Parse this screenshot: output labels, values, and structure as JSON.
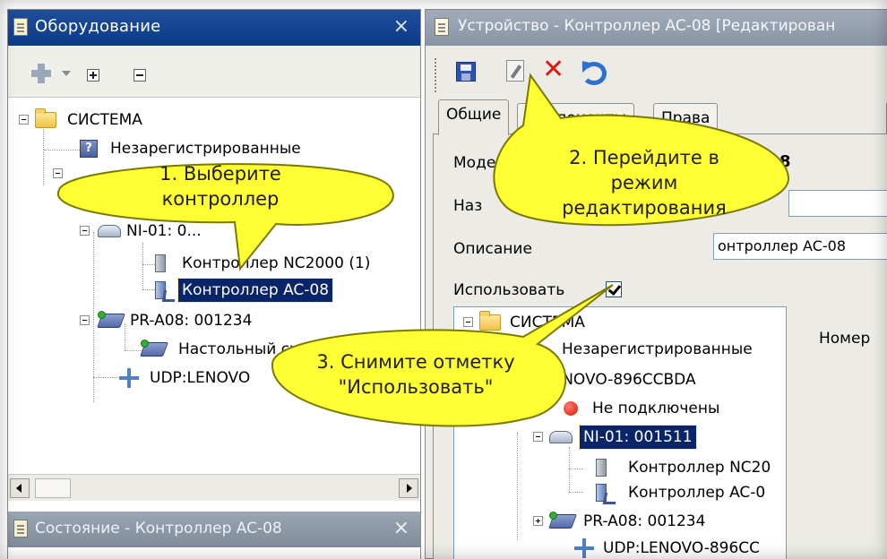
{
  "left_panel": {
    "title": "Оборудование",
    "tree": {
      "root": "СИСТЕМА",
      "unregistered": "Незарегистрированные",
      "hub_partial": "NI-01: 0...",
      "controller_nc2000": "Контроллер NC2000 (1)",
      "controller_ac08": "Контроллер AC-08",
      "pr_a08": "PR-A08: 001234",
      "desktop_partial": "Настольный сч",
      "udp_partial": "UDP:LENOVO"
    }
  },
  "status_panel": {
    "title": "Состояние - Контроллер AC-08"
  },
  "right_panel": {
    "title": "Устройство - Контроллер AC-08 [Редактирован",
    "tabs": [
      "Общие",
      "Компоненты",
      "Права"
    ],
    "form": {
      "model_label": "Моде",
      "model_value": "-08",
      "name_label": "Наз",
      "description_label": "Описание",
      "description_value": "онтроллер AC-08",
      "use_label": "Использовать",
      "use_checked": true,
      "number_label": "Номер"
    },
    "inner_tree": {
      "root": "СИСТЕМА",
      "unregistered": "Незарегистрированные",
      "lenovo": "LENOVO-896CCBDA",
      "not_connected": "Не подключены",
      "hub": "NI-01: 001511",
      "controller_nc": "Контроллер NC20",
      "controller_ac": "Контроллер AC-0",
      "pr_a08": "PR-A08: 001234",
      "udp": "UDP:LENOVO-896CC"
    }
  },
  "callouts": {
    "step1": [
      "1. Выберите",
      "контроллер"
    ],
    "step2": [
      "2. Перейдите в",
      "режим",
      "редактирования"
    ],
    "step3": [
      "3. Снимите отметку",
      "\"Использовать\""
    ]
  },
  "colors": {
    "callout_fill": "#ffff33",
    "callout_stroke": "#7a7a00",
    "active_title": "#0b3b87",
    "inactive_title": "#8893a3",
    "selection": "#0a246a"
  },
  "icons": [
    "folder-icon",
    "question-icon",
    "controller-icon",
    "reader-icon",
    "udp-icon",
    "hub-icon",
    "save-icon",
    "edit-icon",
    "delete-icon",
    "undo-icon",
    "close-icon"
  ]
}
